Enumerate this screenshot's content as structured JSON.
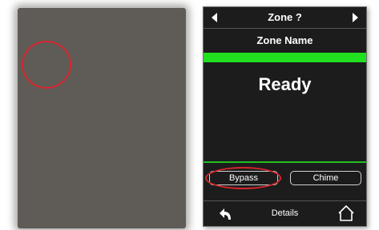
{
  "header": {
    "title": "Zone ?",
    "prev_icon": "arrow-left-icon",
    "next_icon": "arrow-right-icon"
  },
  "zone": {
    "name": "Zone Name",
    "status": "Ready",
    "status_color": "#20e020"
  },
  "buttons": {
    "bypass_label": "Bypass",
    "chime_label": "Chime"
  },
  "footer": {
    "back_icon": "back-arrow-icon",
    "details_label": "Details",
    "home_icon": "home-icon"
  },
  "colors": {
    "screen_background": "#1c1c1c",
    "left_panel": "#5f5c58",
    "highlight": "#d4262c",
    "accent_green": "#20e020"
  }
}
